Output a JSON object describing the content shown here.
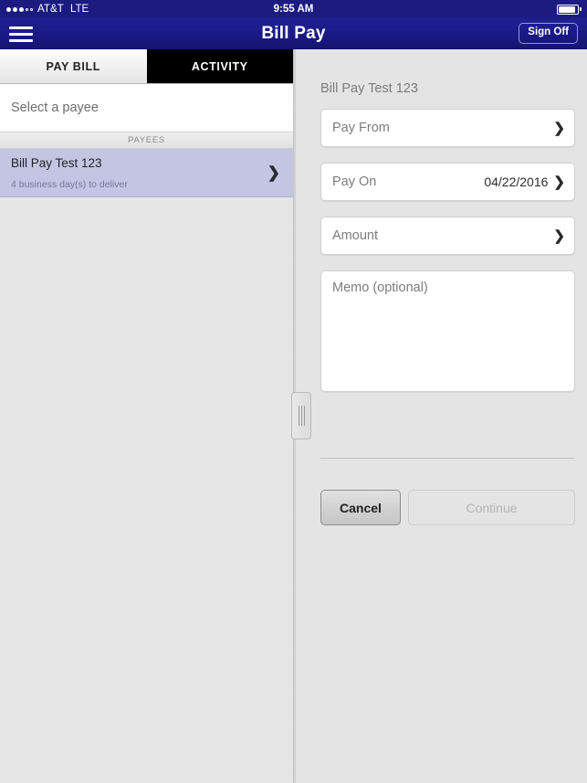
{
  "status_bar": {
    "signal_dots_filled": 3,
    "signal_dots_empty": 2,
    "carrier": "AT&T",
    "network": "LTE",
    "time": "9:55 AM",
    "battery_icon": "battery-icon"
  },
  "nav": {
    "menu_icon": "hamburger-menu-icon",
    "title": "Bill Pay",
    "sign_off_label": "Sign Off",
    "bg_color": "#1a1a86"
  },
  "left_panel": {
    "tabs": [
      {
        "label": "PAY BILL",
        "active": true
      },
      {
        "label": "ACTIVITY",
        "active": false
      }
    ],
    "subheader": "Select a payee",
    "section_header": "PAYEES",
    "payees": [
      {
        "name": "Bill Pay Test 123",
        "detail": "4 business day(s) to deliver",
        "selected": true,
        "chevron": "chevron-right-icon",
        "highlight_color": "#c3c5e3"
      }
    ]
  },
  "right_panel": {
    "title": "Bill Pay Test 123",
    "fields": [
      {
        "label": "Pay From",
        "value": "",
        "chevron": "chevron-right-icon"
      },
      {
        "label": "Pay On",
        "value": "04/22/2016",
        "chevron": "chevron-right-icon"
      },
      {
        "label": "Amount",
        "value": "",
        "chevron": "chevron-right-icon"
      }
    ],
    "memo": {
      "placeholder": "Memo (optional)",
      "value": ""
    },
    "buttons": {
      "cancel_label": "Cancel",
      "continue_label": "Continue",
      "continue_disabled": true
    }
  },
  "split_handle": {
    "icon": "drag-handle-icon"
  }
}
